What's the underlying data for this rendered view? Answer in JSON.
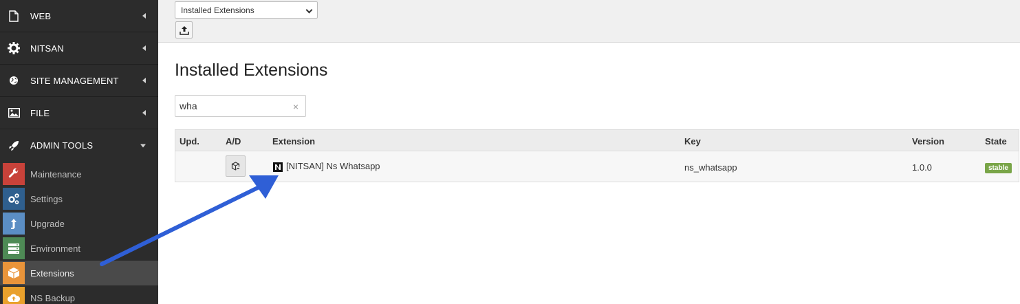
{
  "sidebar": {
    "groups": [
      {
        "label": "WEB",
        "icon": "document-icon"
      },
      {
        "label": "NITSAN",
        "icon": "gear-icon"
      },
      {
        "label": "SITE MANAGEMENT",
        "icon": "globe-icon"
      },
      {
        "label": "FILE",
        "icon": "image-icon"
      },
      {
        "label": "ADMIN TOOLS",
        "icon": "rocket-icon"
      }
    ],
    "items": [
      {
        "label": "Maintenance",
        "icon": "wrench-icon",
        "color": "#c8423a"
      },
      {
        "label": "Settings",
        "icon": "gears-icon",
        "color": "#2f5f8e"
      },
      {
        "label": "Upgrade",
        "icon": "arrow-up-icon",
        "color": "#5b8ec4"
      },
      {
        "label": "Environment",
        "icon": "server-icon",
        "color": "#4e8a55"
      },
      {
        "label": "Extensions",
        "icon": "box-icon",
        "color": "#e9943a"
      },
      {
        "label": "NS Backup",
        "icon": "cloud-upload-icon",
        "color": "#e9a12c"
      }
    ]
  },
  "toolbar": {
    "select_value": "Installed Extensions"
  },
  "main": {
    "title": "Installed Extensions",
    "search_value": "wha",
    "clear_symbol": "×",
    "table": {
      "headers": {
        "upd": "Upd.",
        "ad": "A/D",
        "extension": "Extension",
        "key": "Key",
        "version": "Version",
        "state": "State"
      },
      "rows": [
        {
          "extension": "[NITSAN] Ns Whatsapp",
          "key": "ns_whatsapp",
          "version": "1.0.0",
          "state": "stable"
        }
      ]
    }
  },
  "colors": {
    "sidebar_bg": "#2c2c2c",
    "stable_badge": "#79a548",
    "annotation_arrow": "#2f5fd6"
  }
}
